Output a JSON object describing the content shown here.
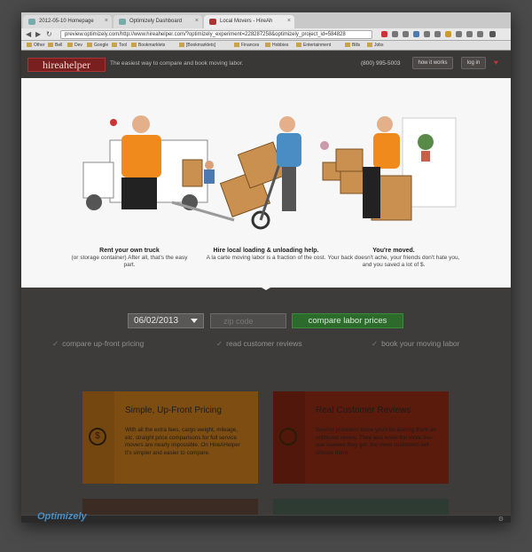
{
  "browser": {
    "tabs": [
      {
        "label": "2012-05-10 Homepage"
      },
      {
        "label": "Optimizely Dashboard"
      },
      {
        "label": "Local Movers - HireAh"
      }
    ],
    "url": "preview.optimizely.com/http://www.hireahelper.com/?optimizely_experiment=228287258&optimizely_project_id=584828",
    "bookmarks": [
      "Other",
      "Bell",
      "Dev",
      "Google",
      "Tool",
      "Bookmarklets",
      "[Bookmarklets]",
      "Finances",
      "Hobbies",
      "Entertainment",
      "Bills",
      "Jobs"
    ]
  },
  "header": {
    "logo": "hireahelper",
    "tagline": "The easiest way to compare and book moving labor.",
    "phone": "(800) 995-5003",
    "how_it_works": "how it works",
    "login": "log in"
  },
  "steps": [
    {
      "title": "Rent your own truck",
      "text": "(or storage container) After all, that's the easy part."
    },
    {
      "title": "Hire local loading & unloading help.",
      "text": "A la carte moving labor is a fraction of the cost."
    },
    {
      "title": "You're moved.",
      "text": "Your back doesn't ache, your friends don't hate you, and you saved a lot of $."
    }
  ],
  "form": {
    "date": "06/02/2013",
    "zip_placeholder": "zip code",
    "submit": "compare labor prices"
  },
  "features": [
    "compare up-front pricing",
    "read customer reviews",
    "book your moving labor"
  ],
  "cards": [
    {
      "title": "Simple, Up-Front Pricing",
      "text": "With all the extra fees, cargo weight, mileage, etc. straight price comparisons for full service movers are nearly impossible. On HireAHelper it's simpler and easier to compare."
    },
    {
      "title": "Real Customer Reviews",
      "text": "Service providers know you'll be leaving them an unfiltered review. They also know the more five-star reviews they get, the more customers will choose them."
    }
  ],
  "optimizely": {
    "logo": "Optimizely"
  }
}
